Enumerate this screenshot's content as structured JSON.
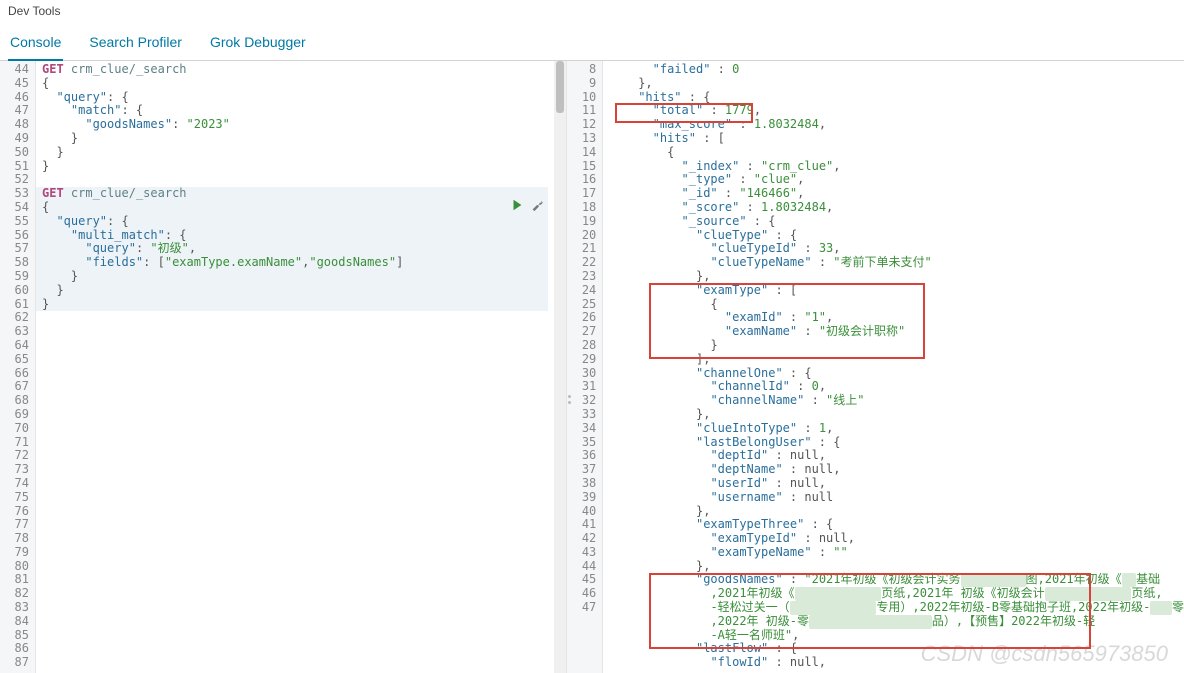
{
  "title": "Dev Tools",
  "tabs": [
    "Console",
    "Search Profiler",
    "Grok Debugger"
  ],
  "left": {
    "startLine": 44,
    "lines": [
      {
        "t": "req",
        "kw": "GET",
        "path": "crm_clue/_search"
      },
      {
        "t": "p",
        "v": "{"
      },
      {
        "t": "kv",
        "ind": 1,
        "k": "\"query\"",
        "v": ": {"
      },
      {
        "t": "kv",
        "ind": 2,
        "k": "\"match\"",
        "v": ": {"
      },
      {
        "t": "kvs",
        "ind": 3,
        "k": "\"goodsNames\"",
        "s": "\"2023\""
      },
      {
        "t": "p",
        "ind": 2,
        "v": "}"
      },
      {
        "t": "p",
        "ind": 1,
        "v": "}"
      },
      {
        "t": "p",
        "v": "}"
      },
      {
        "t": "blank"
      },
      {
        "t": "req",
        "kw": "GET",
        "path": "crm_clue/_search"
      },
      {
        "t": "p",
        "v": "{"
      },
      {
        "t": "kv",
        "ind": 1,
        "k": "\"query\"",
        "v": ": {"
      },
      {
        "t": "kv",
        "ind": 2,
        "k": "\"multi_match\"",
        "v": ": {"
      },
      {
        "t": "kvs",
        "ind": 3,
        "k": "\"query\"",
        "s": "\"初级\"",
        "tr": ","
      },
      {
        "t": "fields",
        "ind": 3,
        "k": "\"fields\"",
        "a": [
          "\"examType.examName\"",
          "\"goodsNames\""
        ]
      },
      {
        "t": "p",
        "ind": 2,
        "v": "}"
      },
      {
        "t": "p",
        "ind": 1,
        "v": "}"
      },
      {
        "t": "p",
        "v": "}"
      },
      {
        "t": "blank"
      },
      {
        "t": "blank"
      },
      {
        "t": "blank"
      },
      {
        "t": "blank"
      },
      {
        "t": "blank"
      },
      {
        "t": "blank"
      },
      {
        "t": "blank"
      },
      {
        "t": "blank"
      },
      {
        "t": "blank"
      },
      {
        "t": "blank"
      },
      {
        "t": "blank"
      },
      {
        "t": "blank"
      },
      {
        "t": "blank"
      },
      {
        "t": "blank"
      },
      {
        "t": "blank"
      },
      {
        "t": "blank"
      },
      {
        "t": "blank"
      },
      {
        "t": "blank"
      },
      {
        "t": "blank"
      },
      {
        "t": "blank"
      },
      {
        "t": "blank"
      },
      {
        "t": "blank"
      },
      {
        "t": "blank"
      },
      {
        "t": "blank"
      },
      {
        "t": "blank"
      },
      {
        "t": "blank"
      }
    ],
    "highlight": {
      "from": 53,
      "to": 61
    }
  },
  "right": {
    "lines": [
      {
        "n": 8,
        "ind": 3,
        "raw": [
          {
            "k": "\"failed\""
          },
          {
            "p": " : "
          },
          {
            "n": "0"
          }
        ]
      },
      {
        "n": 9,
        "ind": 2,
        "raw": [
          {
            "p": "},"
          }
        ]
      },
      {
        "n": 10,
        "ind": 2,
        "raw": [
          {
            "k": "\"hits\""
          },
          {
            "p": " : {"
          }
        ]
      },
      {
        "n": 11,
        "ind": 3,
        "raw": [
          {
            "k": "\"total\""
          },
          {
            "p": " : "
          },
          {
            "n": "1779"
          },
          {
            "p": ","
          }
        ]
      },
      {
        "n": 12,
        "ind": 3,
        "raw": [
          {
            "k": "\"max_score\""
          },
          {
            "p": " : "
          },
          {
            "n": "1.8032484"
          },
          {
            "p": ","
          }
        ]
      },
      {
        "n": 13,
        "ind": 3,
        "raw": [
          {
            "k": "\"hits\""
          },
          {
            "p": " : ["
          }
        ]
      },
      {
        "n": 14,
        "ind": 4,
        "raw": [
          {
            "p": "{"
          }
        ]
      },
      {
        "n": 15,
        "ind": 5,
        "raw": [
          {
            "k": "\"_index\""
          },
          {
            "p": " : "
          },
          {
            "s": "\"crm_clue\""
          },
          {
            "p": ","
          }
        ]
      },
      {
        "n": 16,
        "ind": 5,
        "raw": [
          {
            "k": "\"_type\""
          },
          {
            "p": " : "
          },
          {
            "s": "\"clue\""
          },
          {
            "p": ","
          }
        ]
      },
      {
        "n": 17,
        "ind": 5,
        "raw": [
          {
            "k": "\"_id\""
          },
          {
            "p": " : "
          },
          {
            "s": "\"146466\""
          },
          {
            "p": ","
          }
        ]
      },
      {
        "n": 18,
        "ind": 5,
        "raw": [
          {
            "k": "\"_score\""
          },
          {
            "p": " : "
          },
          {
            "n": "1.8032484"
          },
          {
            "p": ","
          }
        ]
      },
      {
        "n": 19,
        "ind": 5,
        "raw": [
          {
            "k": "\"_source\""
          },
          {
            "p": " : {"
          }
        ]
      },
      {
        "n": 20,
        "ind": 6,
        "raw": [
          {
            "k": "\"clueType\""
          },
          {
            "p": " : {"
          }
        ]
      },
      {
        "n": 21,
        "ind": 7,
        "raw": [
          {
            "k": "\"clueTypeId\""
          },
          {
            "p": " : "
          },
          {
            "n": "33"
          },
          {
            "p": ","
          }
        ]
      },
      {
        "n": 22,
        "ind": 7,
        "raw": [
          {
            "k": "\"clueTypeName\""
          },
          {
            "p": " : "
          },
          {
            "s": "\"考前下单未支付\""
          }
        ]
      },
      {
        "n": 23,
        "ind": 6,
        "raw": [
          {
            "p": "},"
          }
        ]
      },
      {
        "n": 24,
        "ind": 6,
        "raw": [
          {
            "k": "\"examType\""
          },
          {
            "p": " : ["
          }
        ]
      },
      {
        "n": 25,
        "ind": 7,
        "raw": [
          {
            "p": "{"
          }
        ]
      },
      {
        "n": 26,
        "ind": 8,
        "raw": [
          {
            "k": "\"examId\""
          },
          {
            "p": " : "
          },
          {
            "s": "\"1\""
          },
          {
            "p": ","
          }
        ]
      },
      {
        "n": 27,
        "ind": 8,
        "raw": [
          {
            "k": "\"examName\""
          },
          {
            "p": " : "
          },
          {
            "s": "\"初级会计职称\""
          }
        ]
      },
      {
        "n": 28,
        "ind": 7,
        "raw": [
          {
            "p": "}"
          }
        ]
      },
      {
        "n": 29,
        "ind": 6,
        "raw": [
          {
            "p": "],"
          }
        ]
      },
      {
        "n": 30,
        "ind": 6,
        "raw": [
          {
            "k": "\"channelOne\""
          },
          {
            "p": " : {"
          }
        ]
      },
      {
        "n": 31,
        "ind": 7,
        "raw": [
          {
            "k": "\"channelId\""
          },
          {
            "p": " : "
          },
          {
            "n": "0"
          },
          {
            "p": ","
          }
        ]
      },
      {
        "n": 32,
        "ind": 7,
        "raw": [
          {
            "k": "\"channelName\""
          },
          {
            "p": " : "
          },
          {
            "s": "\"线上\""
          }
        ]
      },
      {
        "n": 33,
        "ind": 6,
        "raw": [
          {
            "p": "},"
          }
        ]
      },
      {
        "n": 34,
        "ind": 6,
        "raw": [
          {
            "k": "\"clueIntoType\""
          },
          {
            "p": " : "
          },
          {
            "n": "1"
          },
          {
            "p": ","
          }
        ]
      },
      {
        "n": 35,
        "ind": 6,
        "raw": [
          {
            "k": "\"lastBelongUser\""
          },
          {
            "p": " : {"
          }
        ]
      },
      {
        "n": 36,
        "ind": 7,
        "raw": [
          {
            "k": "\"deptId\""
          },
          {
            "p": " : null,"
          }
        ]
      },
      {
        "n": 37,
        "ind": 7,
        "raw": [
          {
            "k": "\"deptName\""
          },
          {
            "p": " : null,"
          }
        ]
      },
      {
        "n": 38,
        "ind": 7,
        "raw": [
          {
            "k": "\"userId\""
          },
          {
            "p": " : null,"
          }
        ]
      },
      {
        "n": 39,
        "ind": 7,
        "raw": [
          {
            "k": "\"username\""
          },
          {
            "p": " : null"
          }
        ]
      },
      {
        "n": 40,
        "ind": 6,
        "raw": [
          {
            "p": "},"
          }
        ]
      },
      {
        "n": 41,
        "ind": 6,
        "raw": [
          {
            "k": "\"examTypeThree\""
          },
          {
            "p": " : {"
          }
        ]
      },
      {
        "n": 42,
        "ind": 7,
        "raw": [
          {
            "k": "\"examTypeId\""
          },
          {
            "p": " : null,"
          }
        ]
      },
      {
        "n": 43,
        "ind": 7,
        "raw": [
          {
            "k": "\"examTypeName\""
          },
          {
            "p": " : "
          },
          {
            "s": "\"\""
          }
        ]
      },
      {
        "n": 44,
        "ind": 6,
        "raw": [
          {
            "p": "},"
          }
        ]
      },
      {
        "n": 45,
        "ind": 6,
        "goods": true
      },
      {
        "n": 46,
        "ind": 6,
        "raw": [
          {
            "k": "\"lastFlow\""
          },
          {
            "p": " : {"
          }
        ]
      },
      {
        "n": 47,
        "ind": 7,
        "raw": [
          {
            "k": "\"flowId\""
          },
          {
            "p": " : null,"
          }
        ]
      }
    ],
    "goodsText": {
      "l1a": "\"goodsNames\"",
      "l1b": " : ",
      "l1c": "\"2021年初级《初级会计实务",
      "l1d": "图,2021年初级《",
      "l1e": "基础",
      "l2a": ",2021年初级《",
      "l2b": "页纸,2021年 初级《初级会计",
      "l2c": "页纸,",
      "l3a": "-轻松过关一（",
      "l3b": "专用）,2022年初级-B零基础抱子班,2022年初级-",
      "l3c": "零",
      "l4a": ",2022年 初级-零",
      "l4b": "品）,【预售】2022年初级-轻",
      "l5a": "-A轻一名师班\""
    }
  },
  "watermark": "CSDN @csdn565973850"
}
